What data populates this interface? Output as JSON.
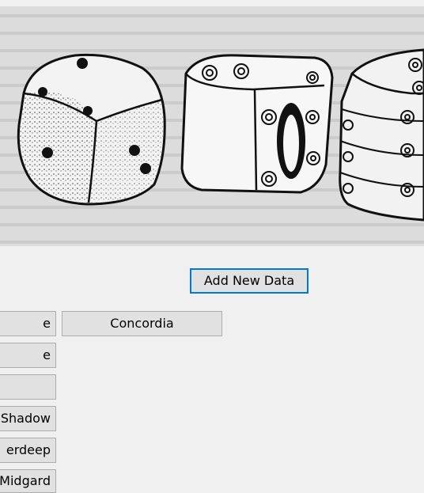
{
  "actions": {
    "add_new_data": "Add New Data"
  },
  "list_buttons": {
    "row1_left": "e",
    "row1_right": "Concordia",
    "row2": "e",
    "row3": "",
    "row4": "l Shadow",
    "row5": "erdeep",
    "row6": "Midgard"
  },
  "image": {
    "subject": "three-dice-illustration"
  }
}
